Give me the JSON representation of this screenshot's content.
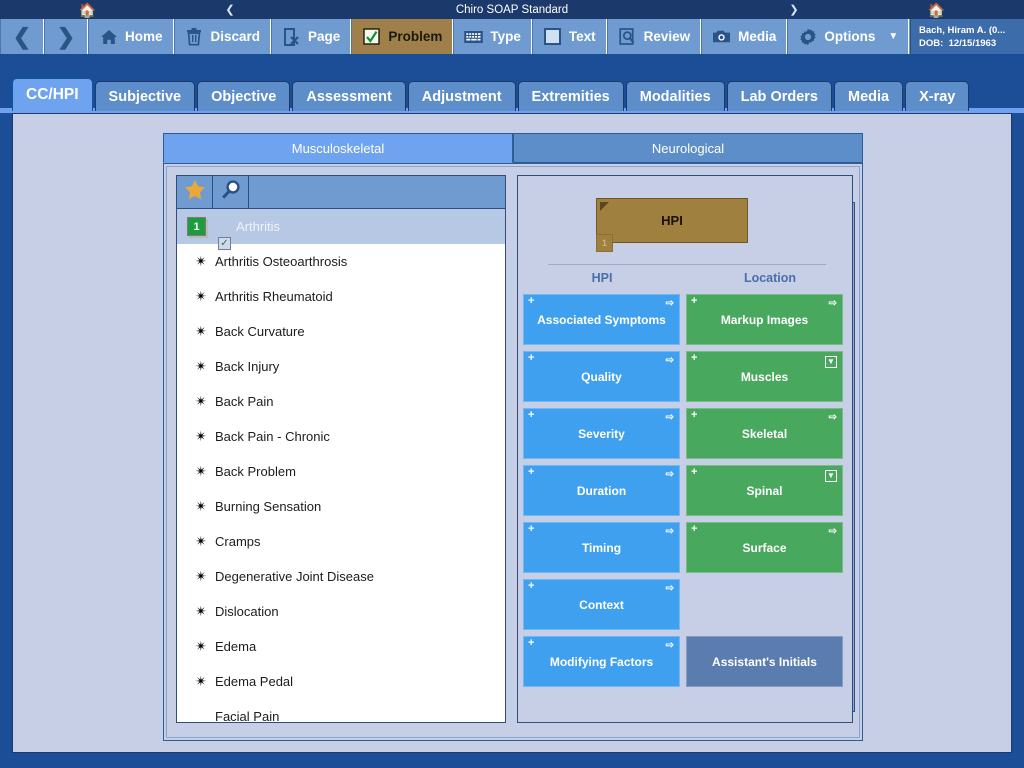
{
  "titlebar": {
    "home_icon": "house-icon",
    "prev_icon": "chevron-left-icon",
    "title": "Chiro SOAP Standard",
    "next_icon": "chevron-right-icon",
    "home_icon_right": "house-icon"
  },
  "toolbar": {
    "back_label": "❮",
    "forward_label": "❯",
    "buttons": [
      {
        "label": "Home",
        "icon": "house-icon",
        "active": false
      },
      {
        "label": "Discard",
        "icon": "trash-icon",
        "active": false
      },
      {
        "label": "Page",
        "icon": "page-delete-icon",
        "active": false
      },
      {
        "label": "Problem",
        "icon": "checkbox-checked-icon",
        "active": true
      },
      {
        "label": "Type",
        "icon": "keyboard-icon",
        "active": false
      },
      {
        "label": "Text",
        "icon": "text-box-icon",
        "active": false
      },
      {
        "label": "Review",
        "icon": "magnifier-doc-icon",
        "active": false
      },
      {
        "label": "Media",
        "icon": "camera-icon",
        "active": false
      },
      {
        "label": "Options",
        "icon": "gear-icon",
        "active": false
      }
    ],
    "options_caret": "▼"
  },
  "patient": {
    "name": "Bach, Hiram A. (0...",
    "dob_label": "DOB:",
    "dob_value": "12/15/1963"
  },
  "main_tabs": [
    {
      "label": "CC/HPI",
      "selected": true
    },
    {
      "label": "Subjective",
      "selected": false
    },
    {
      "label": "Objective",
      "selected": false
    },
    {
      "label": "Assessment",
      "selected": false
    },
    {
      "label": "Adjustment",
      "selected": false
    },
    {
      "label": "Extremities",
      "selected": false
    },
    {
      "label": "Modalities",
      "selected": false
    },
    {
      "label": "Lab Orders",
      "selected": false
    },
    {
      "label": "Media",
      "selected": false
    },
    {
      "label": "X-ray",
      "selected": false
    }
  ],
  "sub_tabs": [
    {
      "label": "Musculoskeletal",
      "selected": true
    },
    {
      "label": "Neurological",
      "selected": false
    }
  ],
  "list_panel": {
    "header": {
      "favorite_icon": "star-icon",
      "search_icon": "magnifier-icon"
    },
    "items": [
      {
        "label": "Arthritis",
        "selected": true,
        "badge": "1",
        "checked": true,
        "check_glyph": "✓"
      },
      {
        "label": "Arthritis Osteoarthrosis",
        "selected": false,
        "bullet": "✴"
      },
      {
        "label": "Arthritis Rheumatoid",
        "selected": false,
        "bullet": "✴"
      },
      {
        "label": "Back Curvature",
        "selected": false,
        "bullet": "✴"
      },
      {
        "label": "Back Injury",
        "selected": false,
        "bullet": "✴"
      },
      {
        "label": "Back Pain",
        "selected": false,
        "bullet": "✴"
      },
      {
        "label": "Back Pain - Chronic",
        "selected": false,
        "bullet": "✴"
      },
      {
        "label": "Back Problem",
        "selected": false,
        "bullet": "✴"
      },
      {
        "label": "Burning Sensation",
        "selected": false,
        "bullet": "✴"
      },
      {
        "label": "Cramps",
        "selected": false,
        "bullet": "✴"
      },
      {
        "label": "Degenerative Joint Disease",
        "selected": false,
        "bullet": "✴"
      },
      {
        "label": "Dislocation",
        "selected": false,
        "bullet": "✴"
      },
      {
        "label": "Edema",
        "selected": false,
        "bullet": "✴"
      },
      {
        "label": "Edema Pedal",
        "selected": false,
        "bullet": "✴"
      },
      {
        "label": "Facial Pain",
        "selected": false,
        "bullet": ""
      }
    ],
    "scrollbar": {
      "top_first_icon": "scroll-to-top-icon",
      "page_up_icon": "double-chevron-up-icon",
      "line_up_icon": "triangle-up-icon",
      "line_down_icon": "triangle-down-icon",
      "page_down_icon": "double-chevron-down-icon",
      "bottom_last_icon": "scroll-to-bottom-icon"
    }
  },
  "detail_panel": {
    "hpi_box": {
      "label": "HPI",
      "number": "1",
      "color": "#a0803f"
    },
    "column_headers": [
      "HPI",
      "Location"
    ],
    "rows": [
      {
        "left": {
          "label": "Associated Symptoms",
          "color": "blue",
          "plus": "+",
          "tr_icon": "arrow-right-icon"
        },
        "right": {
          "label": "Markup Images",
          "color": "green",
          "plus": "+",
          "tr_icon": "arrow-right-icon"
        }
      },
      {
        "left": {
          "label": "Quality",
          "color": "blue",
          "plus": "+",
          "tr_icon": "arrow-right-icon"
        },
        "right": {
          "label": "Muscles",
          "color": "green",
          "plus": "+",
          "tr_icon": "dropdown-box-icon"
        }
      },
      {
        "left": {
          "label": "Severity",
          "color": "blue",
          "plus": "+",
          "tr_icon": "arrow-right-icon"
        },
        "right": {
          "label": "Skeletal",
          "color": "green",
          "plus": "+",
          "tr_icon": "arrow-right-icon"
        }
      },
      {
        "left": {
          "label": "Duration",
          "color": "blue",
          "plus": "+",
          "tr_icon": "arrow-right-icon"
        },
        "right": {
          "label": "Spinal",
          "color": "green",
          "plus": "+",
          "tr_icon": "dropdown-box-icon"
        }
      },
      {
        "left": {
          "label": "Timing",
          "color": "blue",
          "plus": "+",
          "tr_icon": "arrow-right-icon"
        },
        "right": {
          "label": "Surface",
          "color": "green",
          "plus": "+",
          "tr_icon": "arrow-right-icon"
        }
      },
      {
        "left": {
          "label": "Context",
          "color": "blue",
          "plus": "+",
          "tr_icon": "arrow-right-icon"
        },
        "right": null
      },
      {
        "left": {
          "label": "Modifying Factors",
          "color": "blue",
          "plus": "+",
          "tr_icon": "arrow-right-icon"
        },
        "right": {
          "label": "Assistant's Initials",
          "color": "gray",
          "plus": "",
          "tr_icon": ""
        }
      }
    ]
  },
  "colors": {
    "titlebar": "#1b3a6b",
    "toolbar": "#6f9bd1",
    "frame": "#1b4e96",
    "content_bg": "#c7cfe6",
    "tab_selected": "#6fa3ef",
    "tab_normal": "#5d8ec9",
    "active_tool": "#a0804a",
    "hpi_blue": "#40a0f0",
    "location_green": "#48a85e",
    "assistant_gray": "#5b7cae",
    "badge_green": "#1f9b3f",
    "star_gold": "#e8a83a"
  }
}
